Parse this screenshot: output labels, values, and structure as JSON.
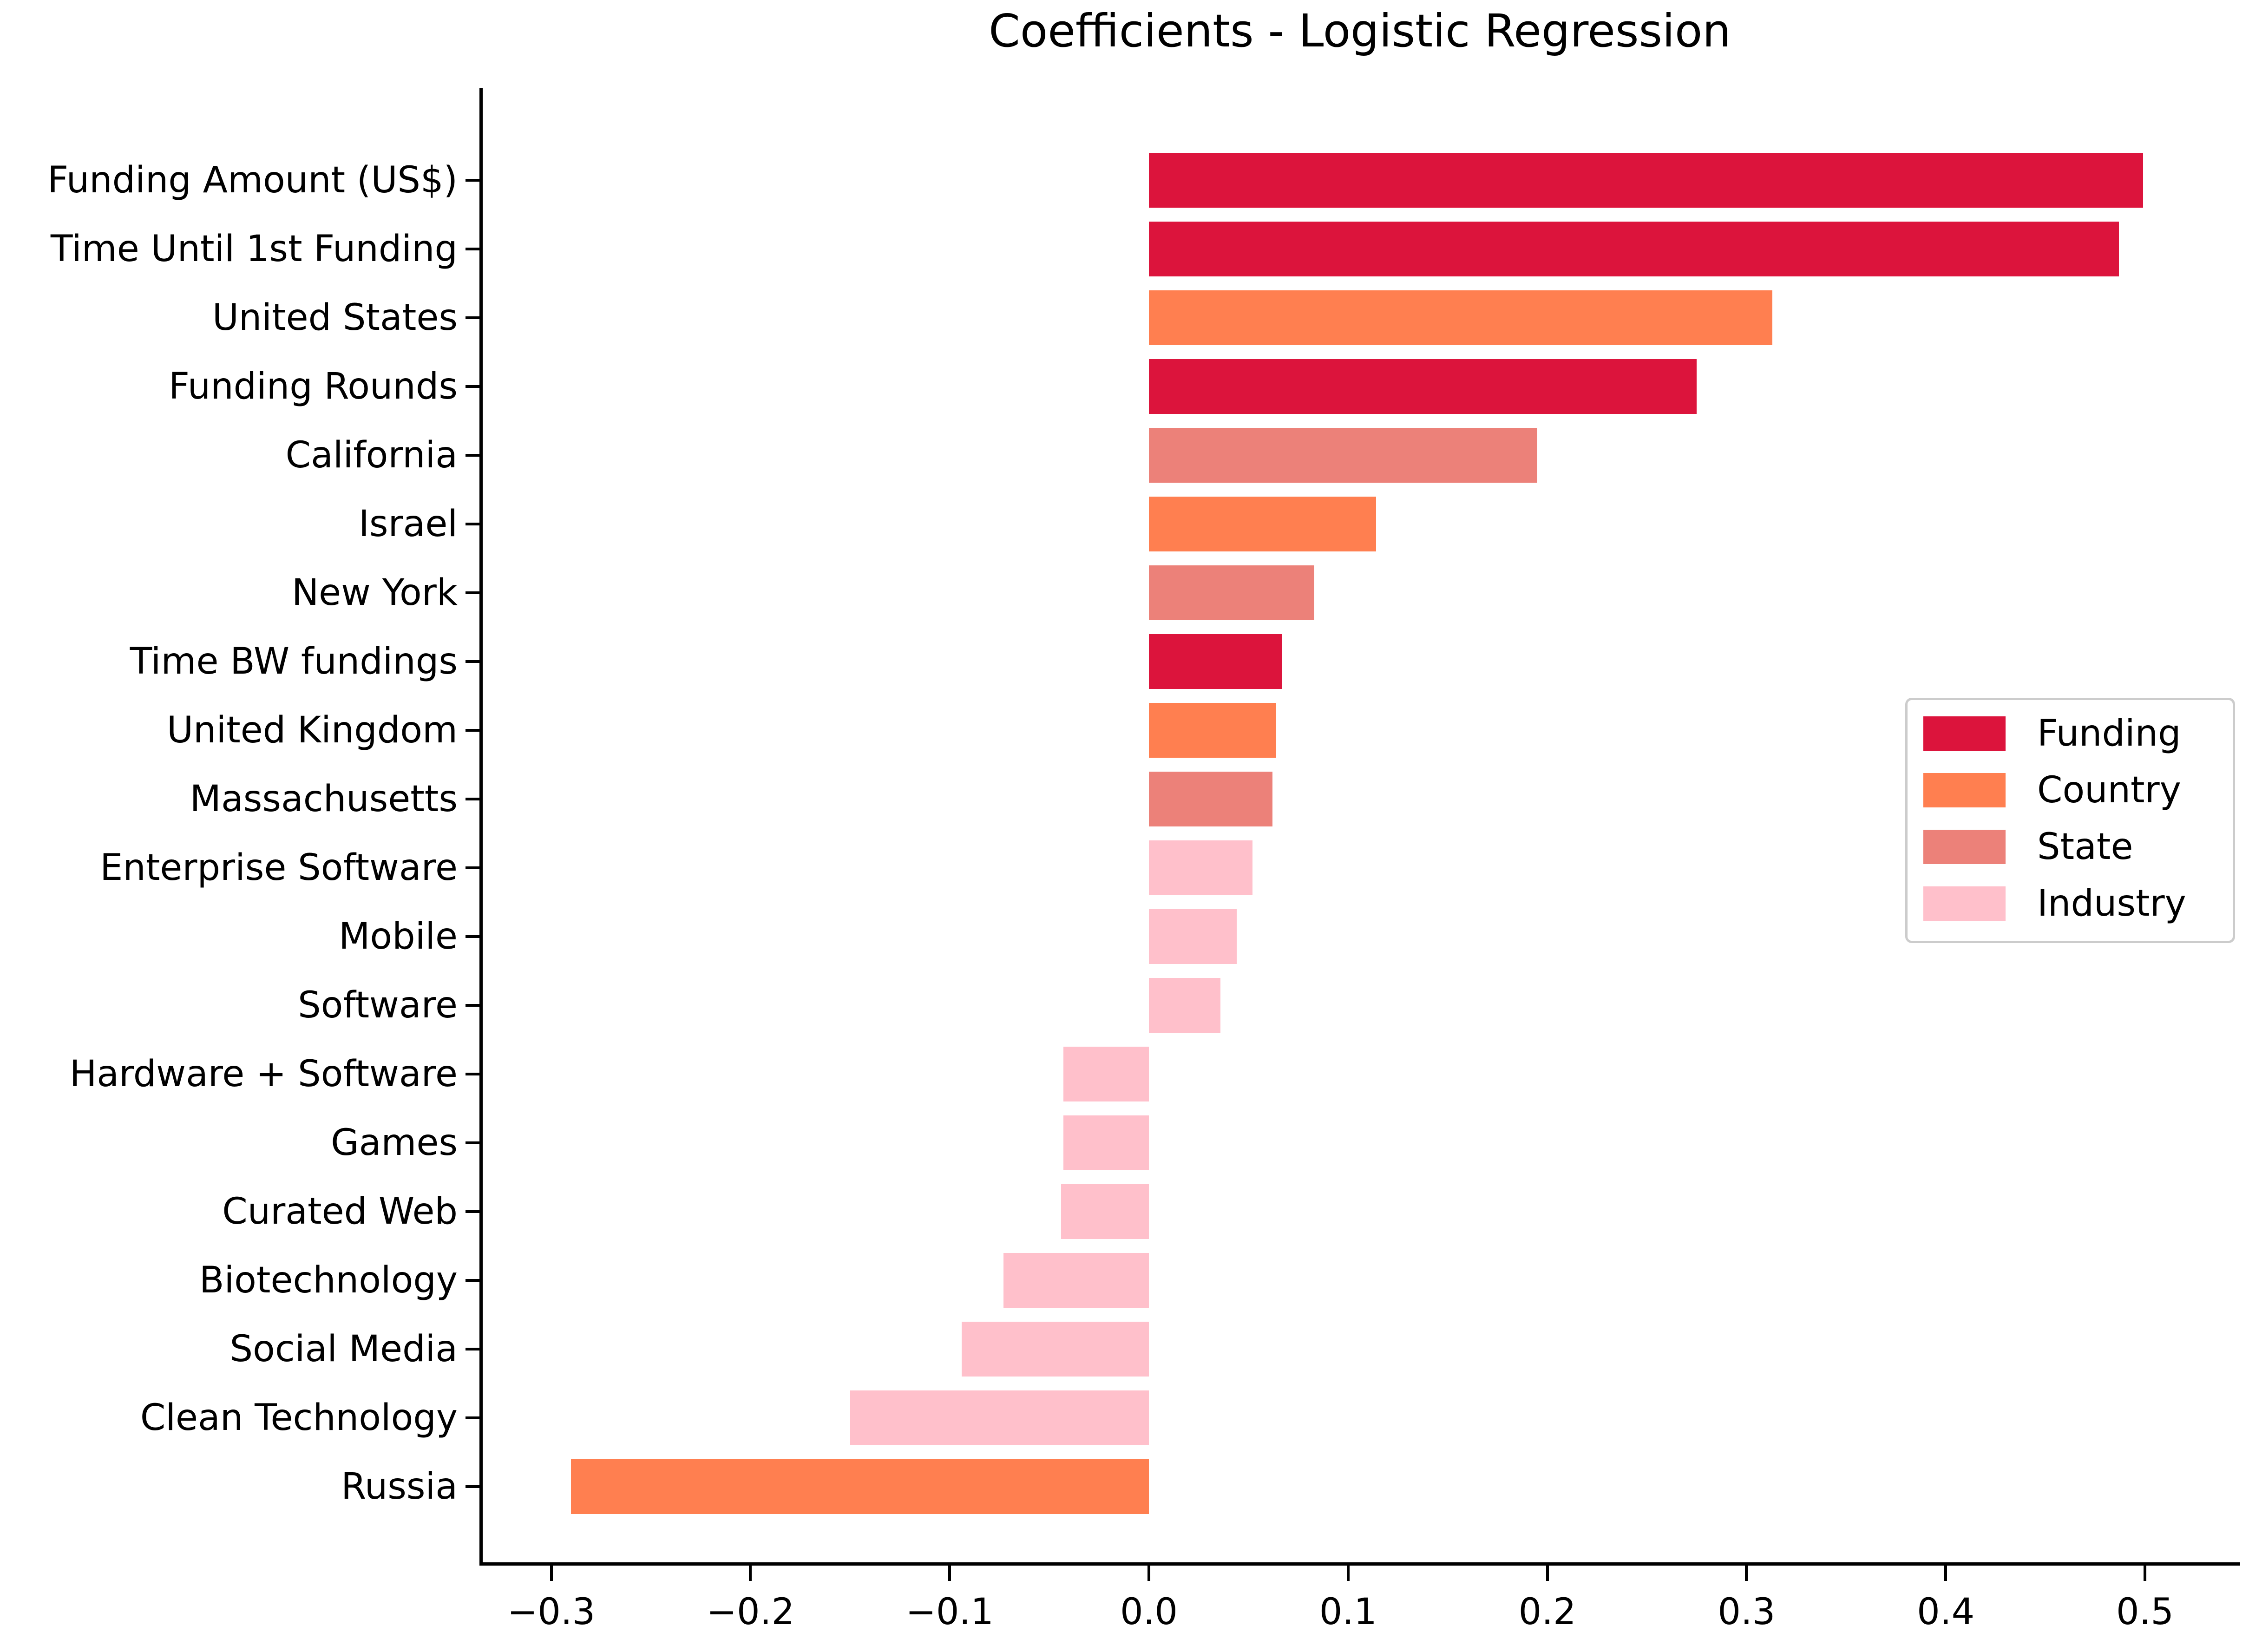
{
  "chart_data": {
    "type": "bar",
    "orientation": "horizontal",
    "title": "Coefficients - Logistic Regression",
    "xlabel": "",
    "ylabel": "",
    "xlim": [
      -0.335,
      0.549
    ],
    "xticks": [
      -0.3,
      -0.2,
      -0.1,
      0.0,
      0.1,
      0.2,
      0.3,
      0.4,
      0.5
    ],
    "xticklabels": [
      "−0.3",
      "−0.2",
      "−0.1",
      "0.0",
      "0.1",
      "0.2",
      "0.3",
      "0.4",
      "0.5"
    ],
    "grid": false,
    "legend_position": "center right",
    "categories": [
      "Funding Amount (US$)",
      "Time Until 1st Funding",
      "United States",
      "Funding Rounds",
      "California",
      "Israel",
      "New York",
      "Time BW fundings",
      "United Kingdom",
      "Massachusetts",
      "Enterprise Software",
      "Mobile",
      "Software",
      "Hardware + Software",
      "Games",
      "Curated Web",
      "Biotechnology",
      "Social Media",
      "Clean Technology",
      "Russia"
    ],
    "values": [
      0.499,
      0.487,
      0.313,
      0.275,
      0.195,
      0.114,
      0.083,
      0.067,
      0.064,
      0.062,
      0.052,
      0.044,
      0.036,
      -0.043,
      -0.043,
      -0.044,
      -0.073,
      -0.094,
      -0.15,
      -0.29
    ],
    "groups": [
      "Funding",
      "Funding",
      "Country",
      "Funding",
      "State",
      "Country",
      "State",
      "Funding",
      "Country",
      "State",
      "Industry",
      "Industry",
      "Industry",
      "Industry",
      "Industry",
      "Industry",
      "Industry",
      "Industry",
      "Industry",
      "Country"
    ],
    "series": [
      {
        "name": "Funding",
        "color": "#DC143C",
        "categories": [
          "Funding Amount (US$)",
          "Time Until 1st Funding",
          "Funding Rounds",
          "Time BW fundings"
        ],
        "values": [
          0.499,
          0.487,
          0.275,
          0.067
        ]
      },
      {
        "name": "Country",
        "color": "#FF7F50",
        "categories": [
          "United States",
          "Israel",
          "United Kingdom",
          "Russia"
        ],
        "values": [
          0.313,
          0.114,
          0.064,
          -0.29
        ]
      },
      {
        "name": "State",
        "color": "#EC8179",
        "categories": [
          "California",
          "New York",
          "Massachusetts"
        ],
        "values": [
          0.195,
          0.083,
          0.062
        ]
      },
      {
        "name": "Industry",
        "color": "#FFC0CB",
        "categories": [
          "Enterprise Software",
          "Mobile",
          "Software",
          "Hardware + Software",
          "Games",
          "Curated Web",
          "Biotechnology",
          "Social Media",
          "Clean Technology"
        ],
        "values": [
          0.052,
          0.044,
          0.036,
          -0.043,
          -0.043,
          -0.044,
          -0.073,
          -0.094,
          -0.15
        ]
      }
    ],
    "legend": [
      {
        "label": "Funding",
        "color": "#DC143C"
      },
      {
        "label": "Country",
        "color": "#FF7F50"
      },
      {
        "label": "State",
        "color": "#EC8179"
      },
      {
        "label": "Industry",
        "color": "#FFC0CB"
      }
    ]
  },
  "colors": {
    "funding": "#DC143C",
    "country": "#FF7F50",
    "state": "#EC8179",
    "industry": "#FFC0CB",
    "axis": "#000000",
    "background": "#FFFFFF",
    "legend_border": "#CCCCCC"
  }
}
